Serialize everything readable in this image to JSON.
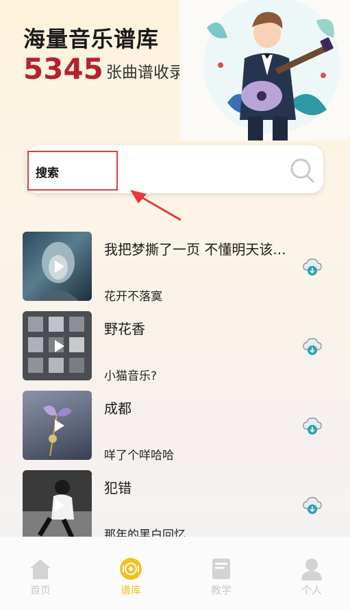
{
  "hero": {
    "title": "海量音乐谱库",
    "count": "5345",
    "count_label": "张曲谱收录"
  },
  "search": {
    "label": "搜索",
    "icon": "search-icon"
  },
  "songs": [
    {
      "title": "我把梦撕了一页 不懂明天该...",
      "artist": "花开不落寞"
    },
    {
      "title": "野花香",
      "artist": "小猫音乐?"
    },
    {
      "title": "成都",
      "artist": "咩了个咩哈哈"
    },
    {
      "title": "犯错",
      "artist": "那年的黑白回忆"
    }
  ],
  "tabs": [
    {
      "label": "首页",
      "icon": "home-icon",
      "active": false
    },
    {
      "label": "谱库",
      "icon": "record-icon",
      "active": true
    },
    {
      "label": "教学",
      "icon": "book-icon",
      "active": false
    },
    {
      "label": "个人",
      "icon": "person-icon",
      "active": false
    }
  ],
  "colors": {
    "accent": "#f4c020",
    "count_red": "#b5222e",
    "highlight_red": "#e53935",
    "icon_teal": "#29a3b8"
  }
}
